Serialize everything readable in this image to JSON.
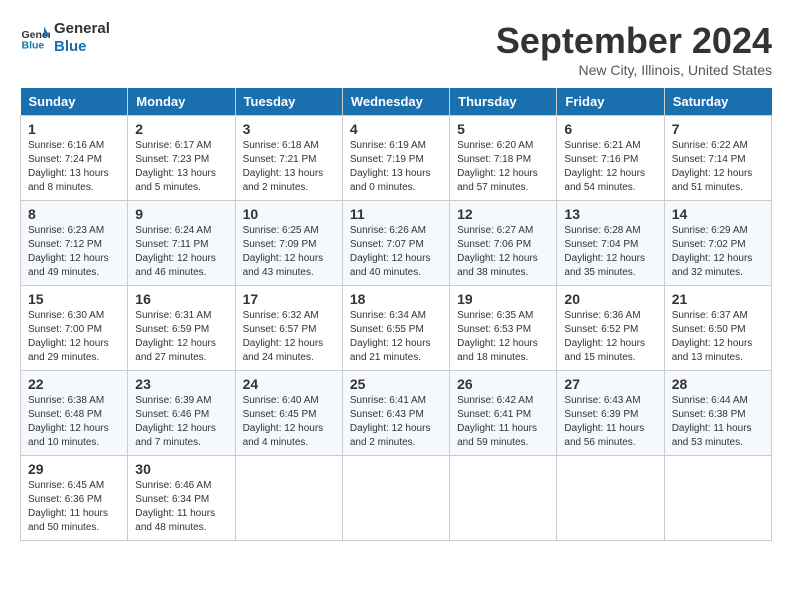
{
  "header": {
    "logo_line1": "General",
    "logo_line2": "Blue",
    "title": "September 2024",
    "subtitle": "New City, Illinois, United States"
  },
  "days_of_week": [
    "Sunday",
    "Monday",
    "Tuesday",
    "Wednesday",
    "Thursday",
    "Friday",
    "Saturday"
  ],
  "weeks": [
    [
      {
        "day": "1",
        "sunrise": "6:16 AM",
        "sunset": "7:24 PM",
        "daylight": "13 hours and 8 minutes."
      },
      {
        "day": "2",
        "sunrise": "6:17 AM",
        "sunset": "7:23 PM",
        "daylight": "13 hours and 5 minutes."
      },
      {
        "day": "3",
        "sunrise": "6:18 AM",
        "sunset": "7:21 PM",
        "daylight": "13 hours and 2 minutes."
      },
      {
        "day": "4",
        "sunrise": "6:19 AM",
        "sunset": "7:19 PM",
        "daylight": "13 hours and 0 minutes."
      },
      {
        "day": "5",
        "sunrise": "6:20 AM",
        "sunset": "7:18 PM",
        "daylight": "12 hours and 57 minutes."
      },
      {
        "day": "6",
        "sunrise": "6:21 AM",
        "sunset": "7:16 PM",
        "daylight": "12 hours and 54 minutes."
      },
      {
        "day": "7",
        "sunrise": "6:22 AM",
        "sunset": "7:14 PM",
        "daylight": "12 hours and 51 minutes."
      }
    ],
    [
      {
        "day": "8",
        "sunrise": "6:23 AM",
        "sunset": "7:12 PM",
        "daylight": "12 hours and 49 minutes."
      },
      {
        "day": "9",
        "sunrise": "6:24 AM",
        "sunset": "7:11 PM",
        "daylight": "12 hours and 46 minutes."
      },
      {
        "day": "10",
        "sunrise": "6:25 AM",
        "sunset": "7:09 PM",
        "daylight": "12 hours and 43 minutes."
      },
      {
        "day": "11",
        "sunrise": "6:26 AM",
        "sunset": "7:07 PM",
        "daylight": "12 hours and 40 minutes."
      },
      {
        "day": "12",
        "sunrise": "6:27 AM",
        "sunset": "7:06 PM",
        "daylight": "12 hours and 38 minutes."
      },
      {
        "day": "13",
        "sunrise": "6:28 AM",
        "sunset": "7:04 PM",
        "daylight": "12 hours and 35 minutes."
      },
      {
        "day": "14",
        "sunrise": "6:29 AM",
        "sunset": "7:02 PM",
        "daylight": "12 hours and 32 minutes."
      }
    ],
    [
      {
        "day": "15",
        "sunrise": "6:30 AM",
        "sunset": "7:00 PM",
        "daylight": "12 hours and 29 minutes."
      },
      {
        "day": "16",
        "sunrise": "6:31 AM",
        "sunset": "6:59 PM",
        "daylight": "12 hours and 27 minutes."
      },
      {
        "day": "17",
        "sunrise": "6:32 AM",
        "sunset": "6:57 PM",
        "daylight": "12 hours and 24 minutes."
      },
      {
        "day": "18",
        "sunrise": "6:34 AM",
        "sunset": "6:55 PM",
        "daylight": "12 hours and 21 minutes."
      },
      {
        "day": "19",
        "sunrise": "6:35 AM",
        "sunset": "6:53 PM",
        "daylight": "12 hours and 18 minutes."
      },
      {
        "day": "20",
        "sunrise": "6:36 AM",
        "sunset": "6:52 PM",
        "daylight": "12 hours and 15 minutes."
      },
      {
        "day": "21",
        "sunrise": "6:37 AM",
        "sunset": "6:50 PM",
        "daylight": "12 hours and 13 minutes."
      }
    ],
    [
      {
        "day": "22",
        "sunrise": "6:38 AM",
        "sunset": "6:48 PM",
        "daylight": "12 hours and 10 minutes."
      },
      {
        "day": "23",
        "sunrise": "6:39 AM",
        "sunset": "6:46 PM",
        "daylight": "12 hours and 7 minutes."
      },
      {
        "day": "24",
        "sunrise": "6:40 AM",
        "sunset": "6:45 PM",
        "daylight": "12 hours and 4 minutes."
      },
      {
        "day": "25",
        "sunrise": "6:41 AM",
        "sunset": "6:43 PM",
        "daylight": "12 hours and 2 minutes."
      },
      {
        "day": "26",
        "sunrise": "6:42 AM",
        "sunset": "6:41 PM",
        "daylight": "11 hours and 59 minutes."
      },
      {
        "day": "27",
        "sunrise": "6:43 AM",
        "sunset": "6:39 PM",
        "daylight": "11 hours and 56 minutes."
      },
      {
        "day": "28",
        "sunrise": "6:44 AM",
        "sunset": "6:38 PM",
        "daylight": "11 hours and 53 minutes."
      }
    ],
    [
      {
        "day": "29",
        "sunrise": "6:45 AM",
        "sunset": "6:36 PM",
        "daylight": "11 hours and 50 minutes."
      },
      {
        "day": "30",
        "sunrise": "6:46 AM",
        "sunset": "6:34 PM",
        "daylight": "11 hours and 48 minutes."
      },
      null,
      null,
      null,
      null,
      null
    ]
  ],
  "labels": {
    "sunrise": "Sunrise:",
    "sunset": "Sunset:",
    "daylight": "Daylight:"
  }
}
